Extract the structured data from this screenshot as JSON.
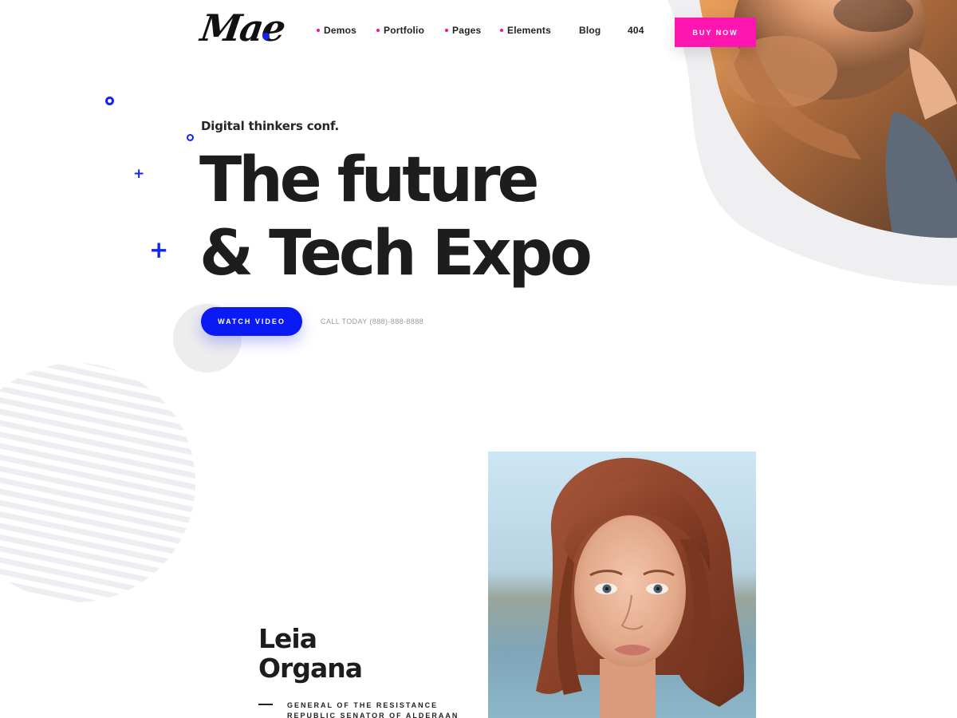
{
  "header": {
    "logo_text": "Mae",
    "nav": [
      {
        "label": "Demos",
        "has_dot": true
      },
      {
        "label": "Portfolio",
        "has_dot": true
      },
      {
        "label": "Pages",
        "has_dot": true
      },
      {
        "label": "Elements",
        "has_dot": true
      },
      {
        "label": "Blog",
        "has_dot": false
      },
      {
        "label": "404",
        "has_dot": false
      }
    ],
    "buy_now_label": "BUY NOW"
  },
  "hero": {
    "eyebrow": "Digital thinkers conf.",
    "headline_line1": "The future",
    "headline_line2": "& Tech Expo",
    "watch_video_label": "WATCH VIDEO",
    "call_text": "CALL TODAY (888)-888-8888"
  },
  "speaker": {
    "first_name": "Leia",
    "last_name": "Organa",
    "role_line1": "GENERAL OF THE RESISTANCE",
    "role_line2": "REPUBLIC SENATOR OF ALDERAAN"
  },
  "colors": {
    "accent_blue": "#0a1af5",
    "accent_pink": "#ff16b1",
    "nav_dot": "#f70d9c",
    "blob_gray": "#efeff1"
  },
  "icons": {
    "ring": "circle-outline-icon",
    "plus": "plus-icon"
  }
}
